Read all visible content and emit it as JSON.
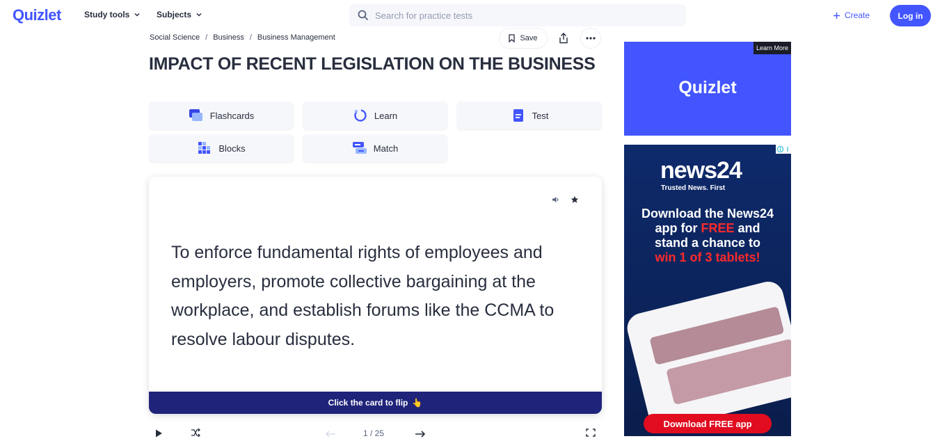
{
  "header": {
    "logo": "Quizlet",
    "nav": [
      "Study tools",
      "Subjects"
    ],
    "search_placeholder": "Search for practice tests",
    "create_label": "Create",
    "login_label": "Log in"
  },
  "breadcrumb": [
    "Social Science",
    "Business",
    "Business Management"
  ],
  "actions": {
    "save_label": "Save"
  },
  "page_title": "IMPACT OF RECENT LEGISLATION ON THE BUSINESS",
  "modes": [
    "Flashcards",
    "Learn",
    "Test",
    "Blocks",
    "Match"
  ],
  "flashcard": {
    "text": "To enforce fundamental rights of employees and employers, promote collective bargaining at the workplace, and establish forums like the CCMA to resolve labour disputes.",
    "flip_hint": "Click the card to flip",
    "flip_emoji": "👆"
  },
  "controls": {
    "counter": "1 / 25"
  },
  "ads": {
    "ad1": {
      "learn_more": "Learn More",
      "brand": "Quizlet"
    },
    "ad2": {
      "brand": "news24",
      "tagline": "Trusted News. First",
      "headline_1": "Download the News24",
      "headline_2a": "app for ",
      "headline_2b": "FREE",
      "headline_2c": " and",
      "headline_3": "stand a chance to",
      "headline_4": "win 1 of 3 tablets!",
      "button": "Download FREE app"
    }
  },
  "colors": {
    "brand": "#4255ff",
    "flipbar": "#1f237a",
    "news_red": "#e10c20"
  }
}
